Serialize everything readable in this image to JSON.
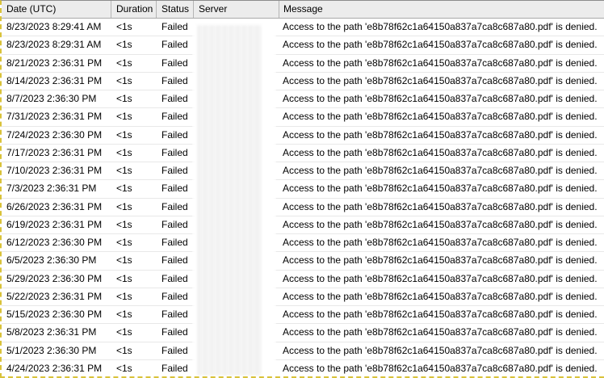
{
  "columns": {
    "date": "Date (UTC)",
    "duration": "Duration",
    "status": "Status",
    "server": "Server",
    "message": "Message"
  },
  "rows": [
    {
      "date": "8/23/2023 8:29:41 AM",
      "duration": "<1s",
      "status": "Failed",
      "message": "Access to the path 'e8b78f62c1a64150a837a7ca8c687a80.pdf' is denied."
    },
    {
      "date": "8/23/2023 8:29:31 AM",
      "duration": "<1s",
      "status": "Failed",
      "message": "Access to the path 'e8b78f62c1a64150a837a7ca8c687a80.pdf' is denied."
    },
    {
      "date": "8/21/2023 2:36:31 PM",
      "duration": "<1s",
      "status": "Failed",
      "message": "Access to the path 'e8b78f62c1a64150a837a7ca8c687a80.pdf' is denied."
    },
    {
      "date": "8/14/2023 2:36:31 PM",
      "duration": "<1s",
      "status": "Failed",
      "message": "Access to the path 'e8b78f62c1a64150a837a7ca8c687a80.pdf' is denied."
    },
    {
      "date": "8/7/2023 2:36:30 PM",
      "duration": "<1s",
      "status": "Failed",
      "message": "Access to the path 'e8b78f62c1a64150a837a7ca8c687a80.pdf' is denied."
    },
    {
      "date": "7/31/2023 2:36:31 PM",
      "duration": "<1s",
      "status": "Failed",
      "message": "Access to the path 'e8b78f62c1a64150a837a7ca8c687a80.pdf' is denied."
    },
    {
      "date": "7/24/2023 2:36:30 PM",
      "duration": "<1s",
      "status": "Failed",
      "message": "Access to the path 'e8b78f62c1a64150a837a7ca8c687a80.pdf' is denied."
    },
    {
      "date": "7/17/2023 2:36:31 PM",
      "duration": "<1s",
      "status": "Failed",
      "message": "Access to the path 'e8b78f62c1a64150a837a7ca8c687a80.pdf' is denied."
    },
    {
      "date": "7/10/2023 2:36:31 PM",
      "duration": "<1s",
      "status": "Failed",
      "message": "Access to the path 'e8b78f62c1a64150a837a7ca8c687a80.pdf' is denied."
    },
    {
      "date": "7/3/2023 2:36:31 PM",
      "duration": "<1s",
      "status": "Failed",
      "message": "Access to the path 'e8b78f62c1a64150a837a7ca8c687a80.pdf' is denied."
    },
    {
      "date": "6/26/2023 2:36:31 PM",
      "duration": "<1s",
      "status": "Failed",
      "message": "Access to the path 'e8b78f62c1a64150a837a7ca8c687a80.pdf' is denied."
    },
    {
      "date": "6/19/2023 2:36:31 PM",
      "duration": "<1s",
      "status": "Failed",
      "message": "Access to the path 'e8b78f62c1a64150a837a7ca8c687a80.pdf' is denied."
    },
    {
      "date": "6/12/2023 2:36:30 PM",
      "duration": "<1s",
      "status": "Failed",
      "message": "Access to the path 'e8b78f62c1a64150a837a7ca8c687a80.pdf' is denied."
    },
    {
      "date": "6/5/2023 2:36:30 PM",
      "duration": "<1s",
      "status": "Failed",
      "message": "Access to the path 'e8b78f62c1a64150a837a7ca8c687a80.pdf' is denied."
    },
    {
      "date": "5/29/2023 2:36:30 PM",
      "duration": "<1s",
      "status": "Failed",
      "message": "Access to the path 'e8b78f62c1a64150a837a7ca8c687a80.pdf' is denied."
    },
    {
      "date": "5/22/2023 2:36:31 PM",
      "duration": "<1s",
      "status": "Failed",
      "message": "Access to the path 'e8b78f62c1a64150a837a7ca8c687a80.pdf' is denied."
    },
    {
      "date": "5/15/2023 2:36:30 PM",
      "duration": "<1s",
      "status": "Failed",
      "message": "Access to the path 'e8b78f62c1a64150a837a7ca8c687a80.pdf' is denied."
    },
    {
      "date": "5/8/2023 2:36:31 PM",
      "duration": "<1s",
      "status": "Failed",
      "message": "Access to the path 'e8b78f62c1a64150a837a7ca8c687a80.pdf' is denied."
    },
    {
      "date": "5/1/2023 2:36:30 PM",
      "duration": "<1s",
      "status": "Failed",
      "message": "Access to the path 'e8b78f62c1a64150a837a7ca8c687a80.pdf' is denied."
    },
    {
      "date": "4/24/2023 2:36:31 PM",
      "duration": "<1s",
      "status": "Failed",
      "message": "Access to the path 'e8b78f62c1a64150a837a7ca8c687a80.pdf' is denied."
    }
  ]
}
